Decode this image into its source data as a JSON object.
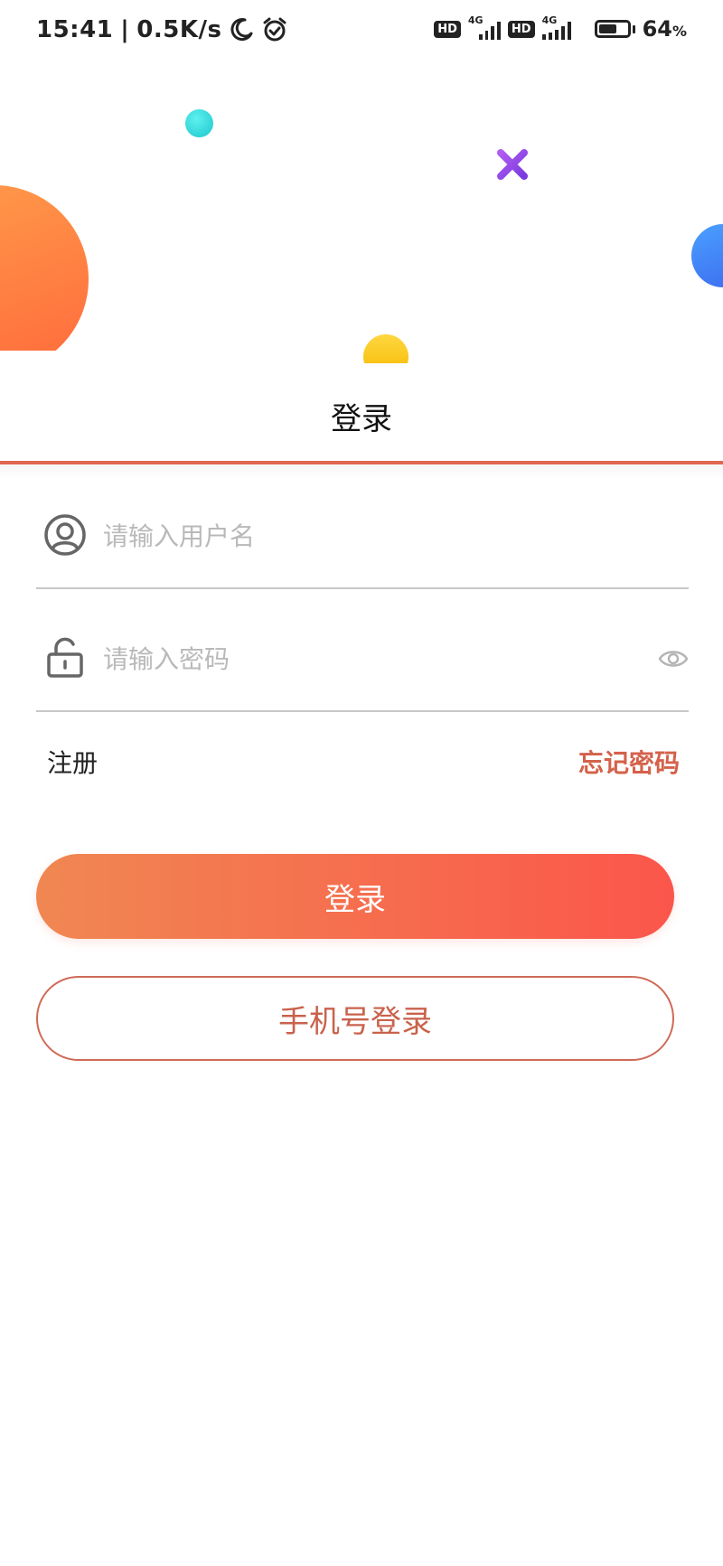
{
  "status_bar": {
    "time": "15:41",
    "separator": "|",
    "network_speed": "0.5K/s",
    "left_icons": [
      "moon-icon",
      "alarm-icon"
    ],
    "sim1_badge": "HD",
    "sim1_network": "4G",
    "sim2_badge": "HD",
    "sim2_network": "4G",
    "battery_level": 0.64,
    "battery_text": "64",
    "battery_unit": "%"
  },
  "decorations": {
    "teal": "#1bc7cc",
    "orange": "#ff6a3c",
    "blue": "#3d6bf0",
    "yellow": "#f5b800",
    "purple": "#8a45e8"
  },
  "header": {
    "title": "登录",
    "accent_color": "#e0674f"
  },
  "form": {
    "username": {
      "icon": "user-icon",
      "placeholder": "请输入用户名",
      "value": ""
    },
    "password": {
      "icon": "lock-icon",
      "placeholder": "请输入密码",
      "value": "",
      "toggle_icon": "eye-icon"
    }
  },
  "links": {
    "register": "注册",
    "forgot_password": "忘记密码"
  },
  "buttons": {
    "login": "登录",
    "phone_login": "手机号登录"
  },
  "colors": {
    "primary": "#fb564b",
    "primary_start": "#f08752",
    "outline": "#cf6a56"
  }
}
